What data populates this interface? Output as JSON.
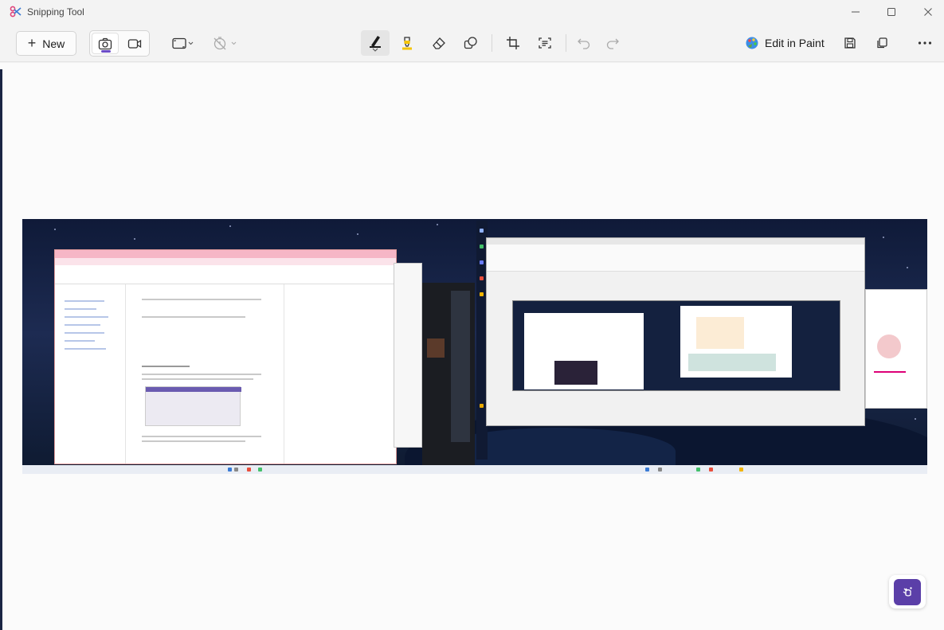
{
  "window": {
    "title": "Snipping Tool"
  },
  "toolbar": {
    "new_label": "New",
    "edit_in_paint_label": "Edit in Paint"
  },
  "icons": {
    "app": "snipping-tool-icon",
    "minimize": "minimize-icon",
    "maximize": "maximize-icon",
    "close": "close-icon",
    "screenshot_mode": "camera-icon",
    "video_mode": "video-camera-icon",
    "snip_shape": "rectangle-snip-icon",
    "delay": "timer-off-icon",
    "pen": "ballpoint-pen-icon",
    "highlighter": "highlighter-icon",
    "eraser": "eraser-icon",
    "shapes": "shapes-icon",
    "crop": "crop-icon",
    "text_actions": "text-actions-icon",
    "undo": "undo-icon",
    "redo": "redo-icon",
    "paint": "paint-icon",
    "save": "save-icon",
    "copy": "copy-icon",
    "more": "more-options-icon",
    "copilot": "copilot-icon"
  },
  "colors": {
    "accent": "#6b4cc7",
    "pen_color": "#1b1b1b",
    "highlighter_color": "#f5c400",
    "copilot_bg": "#5b3fa8"
  }
}
